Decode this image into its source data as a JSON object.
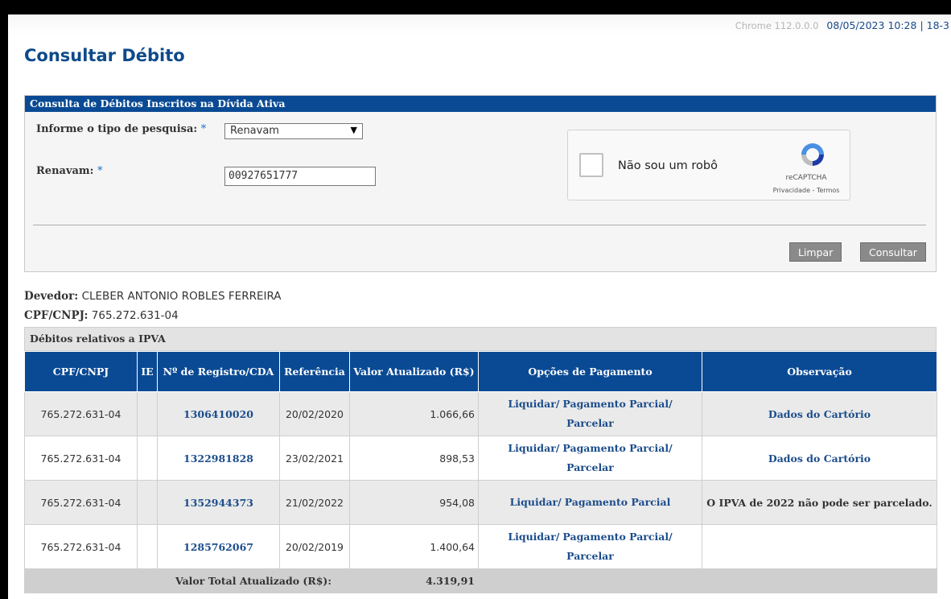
{
  "browser": {
    "version": "Chrome 112.0.0.0",
    "datetime": "08/05/2023 10:28 | 18-3"
  },
  "page_title": "Consultar Débito",
  "search_panel": {
    "title": "Consulta de Débitos Inscritos na Dívida Ativa",
    "type_label": "Informe o tipo de pesquisa:",
    "type_value": "Renavam",
    "renavam_label": "Renavam:",
    "renavam_value": "00927651777",
    "required_mark": "*"
  },
  "captcha": {
    "label": "Não sou um robô",
    "brand": "reCAPTCHA",
    "links": "Privacidade - Termos"
  },
  "buttons": {
    "clear": "Limpar",
    "submit": "Consultar"
  },
  "debtor": {
    "label": "Devedor:",
    "name": "CLEBER ANTONIO ROBLES FERREIRA",
    "doc_label": "CPF/CNPJ:",
    "doc": "765.272.631-04"
  },
  "ipva_section": "Débitos relativos a IPVA",
  "table": {
    "headers": {
      "cpf": "CPF/CNPJ",
      "ie": "IE",
      "registro": "Nº de Registro/CDA",
      "referencia": "Referência",
      "valor": "Valor Atualizado (R$)",
      "opcoes": "Opções de Pagamento",
      "obs": "Observação"
    },
    "rows": [
      {
        "cpf": "765.272.631-04",
        "ie": "",
        "registro": "1306410020",
        "referencia": "20/02/2020",
        "valor": "1.066,66",
        "liquidar": "Liquidar/",
        "parcial": "Pagamento Parcial/",
        "parcelar": "Parcelar",
        "obs": "Dados do Cartório"
      },
      {
        "cpf": "765.272.631-04",
        "ie": "",
        "registro": "1322981828",
        "referencia": "23/02/2021",
        "valor": "898,53",
        "liquidar": "Liquidar/",
        "parcial": "Pagamento Parcial/",
        "parcelar": "Parcelar",
        "obs": "Dados do Cartório"
      },
      {
        "cpf": "765.272.631-04",
        "ie": "",
        "registro": "1352944373",
        "referencia": "21/02/2022",
        "valor": "954,08",
        "liquidar": "Liquidar/",
        "parcial": "Pagamento Parcial",
        "parcelar": "",
        "obs": "O IPVA de 2022 não pode ser parcelado."
      },
      {
        "cpf": "765.272.631-04",
        "ie": "",
        "registro": "1285762067",
        "referencia": "20/02/2019",
        "valor": "1.400,64",
        "liquidar": "Liquidar/",
        "parcial": "Pagamento Parcial/",
        "parcelar": "Parcelar",
        "obs": ""
      }
    ],
    "total_label": "Valor Total Atualizado (R$):",
    "total_value": "4.319,91"
  }
}
